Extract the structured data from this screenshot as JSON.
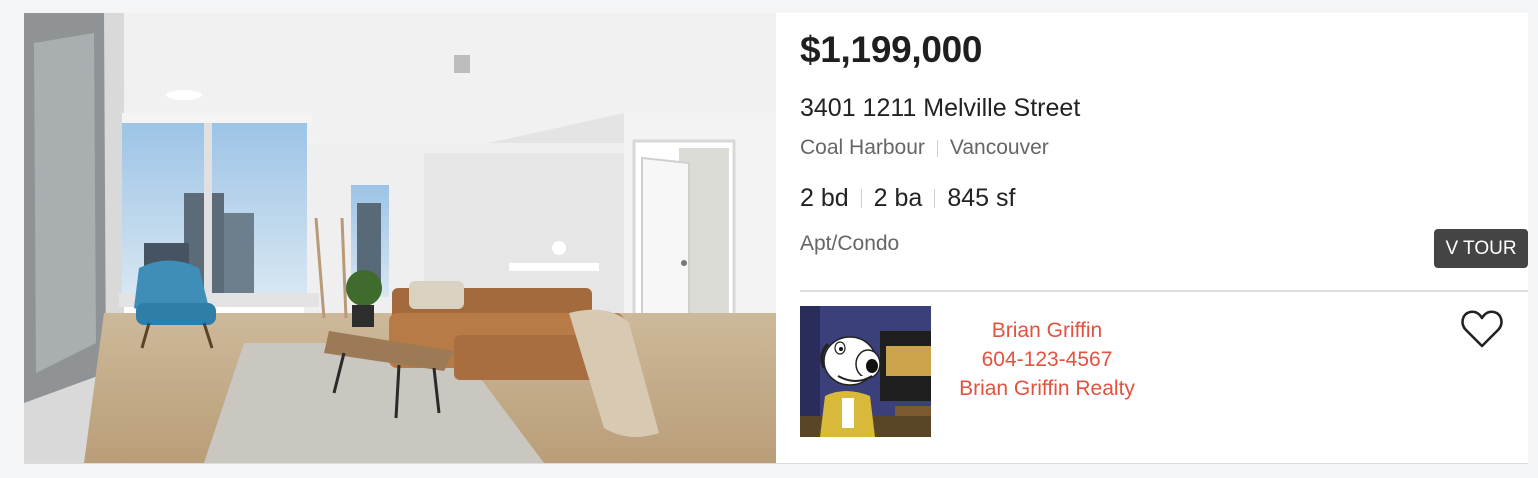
{
  "listing": {
    "price": "$1,199,000",
    "address": "3401 1211 Melville Street",
    "neighborhood": "Coal Harbour",
    "city": "Vancouver",
    "beds": "2 bd",
    "baths": "2 ba",
    "area": "845 sf",
    "property_type": "Apt/Condo",
    "tour_label": "V TOUR"
  },
  "agent": {
    "name": "Brian Griffin",
    "phone": "604-123-4567",
    "brokerage": "Brian Griffin Realty"
  },
  "icons": {
    "favorite": "heart-outline-icon"
  },
  "colors": {
    "agent_text": "#e2523f",
    "tour_badge_bg": "#444444",
    "price_text": "#1f1f1f"
  }
}
